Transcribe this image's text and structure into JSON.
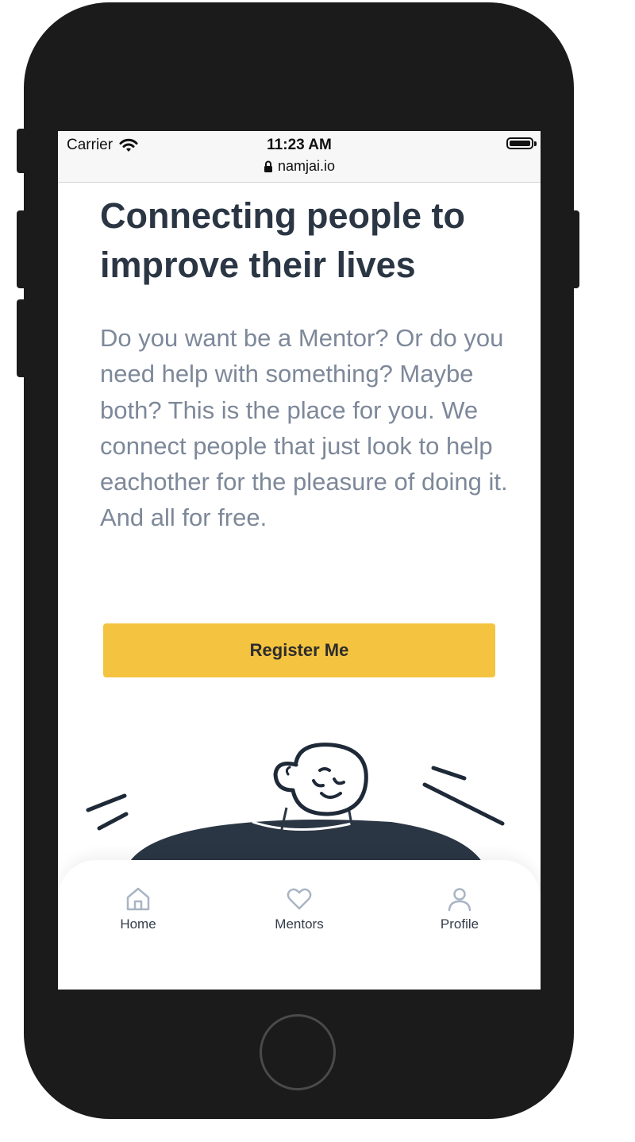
{
  "status_bar": {
    "carrier": "Carrier",
    "time": "11:23 AM",
    "url": "namjai.io"
  },
  "hero": {
    "title": "Connecting people to improve their lives",
    "description": "Do you want be a Mentor? Or do you need help with something? Maybe both? This is the place for you. We connect people that just look to help eachother for the pleasure of doing it. And all for free.",
    "cta_label": "Register Me"
  },
  "tab_bar": {
    "items": [
      {
        "label": "Home",
        "icon": "home-icon"
      },
      {
        "label": "Mentors",
        "icon": "heart-icon"
      },
      {
        "label": "Profile",
        "icon": "user-icon"
      }
    ]
  },
  "colors": {
    "accent": "#f4c33f",
    "heading": "#2b3644",
    "body_text": "#7d8899",
    "phone_frame": "#1b1b1b"
  }
}
